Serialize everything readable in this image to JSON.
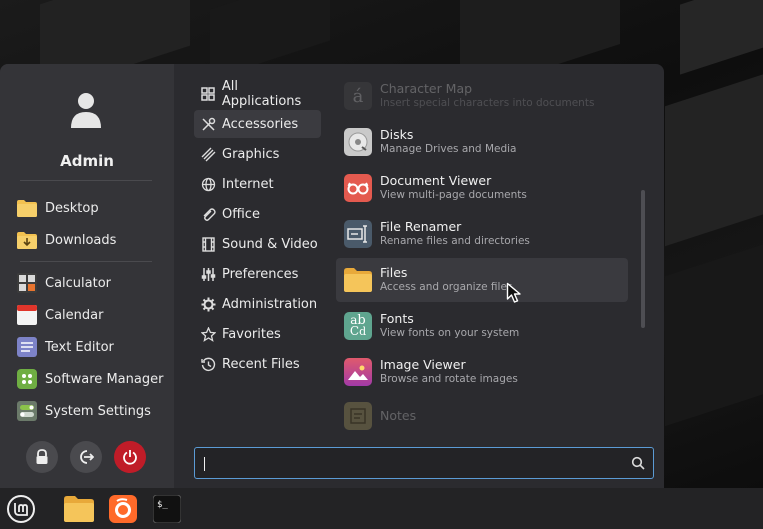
{
  "user": {
    "name": "Admin"
  },
  "favorites": [
    {
      "label": "Desktop",
      "icon": "folder-desktop-icon"
    },
    {
      "label": "Downloads",
      "icon": "folder-downloads-icon"
    },
    {
      "label": "Calculator",
      "icon": "calculator-icon"
    },
    {
      "label": "Calendar",
      "icon": "calendar-icon"
    },
    {
      "label": "Text Editor",
      "icon": "text-editor-icon"
    },
    {
      "label": "Software Manager",
      "icon": "software-manager-icon"
    },
    {
      "label": "System Settings",
      "icon": "system-settings-icon"
    }
  ],
  "session_buttons": [
    {
      "icon": "lock-icon"
    },
    {
      "icon": "logout-icon"
    },
    {
      "icon": "power-icon"
    }
  ],
  "categories": [
    {
      "label": "All Applications",
      "icon": "grid-icon"
    },
    {
      "label": "Accessories",
      "icon": "tools-icon",
      "active": true
    },
    {
      "label": "Graphics",
      "icon": "palette-icon"
    },
    {
      "label": "Internet",
      "icon": "globe-icon"
    },
    {
      "label": "Office",
      "icon": "paperclip-icon"
    },
    {
      "label": "Sound & Video",
      "icon": "film-icon"
    },
    {
      "label": "Preferences",
      "icon": "sliders-icon"
    },
    {
      "label": "Administration",
      "icon": "gear-icon"
    },
    {
      "label": "Favorites",
      "icon": "star-icon"
    },
    {
      "label": "Recent Files",
      "icon": "history-icon"
    }
  ],
  "apps": [
    {
      "name": "Character Map",
      "desc": "Insert special characters into documents",
      "icon": "character-map-icon"
    },
    {
      "name": "Disks",
      "desc": "Manage Drives and Media",
      "icon": "disks-icon"
    },
    {
      "name": "Document Viewer",
      "desc": "View multi-page documents",
      "icon": "document-viewer-icon"
    },
    {
      "name": "File Renamer",
      "desc": "Rename files and directories",
      "icon": "file-renamer-icon"
    },
    {
      "name": "Files",
      "desc": "Access and organize files",
      "icon": "files-icon"
    },
    {
      "name": "Fonts",
      "desc": "View fonts on your system",
      "icon": "fonts-icon"
    },
    {
      "name": "Image Viewer",
      "desc": "Browse and rotate images",
      "icon": "image-viewer-icon"
    },
    {
      "name": "Notes",
      "desc": "",
      "icon": "notes-icon"
    }
  ],
  "search": {
    "value": "",
    "placeholder": ""
  },
  "taskbar": [
    {
      "icon": "mint-menu-icon"
    },
    {
      "icon": "files-icon"
    },
    {
      "icon": "firefox-icon"
    },
    {
      "icon": "terminal-icon"
    }
  ],
  "colors": {
    "accent": "#5b9bd5",
    "power": "#c01c28",
    "folder": "#f2c150"
  }
}
